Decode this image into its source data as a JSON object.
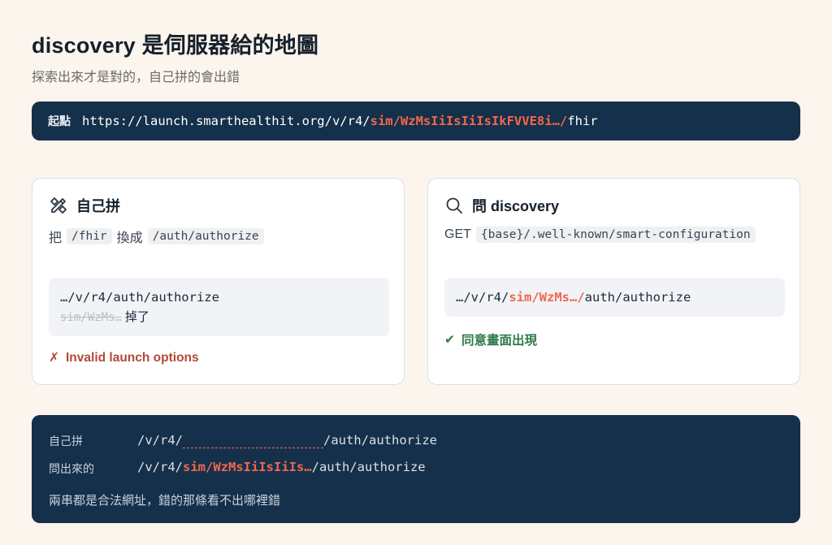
{
  "header": {
    "title": "discovery 是伺服器給的地圖",
    "subtitle": "探索出來才是對的，自己拼的會出錯"
  },
  "origin": {
    "label": "起點",
    "url_prefix": "https://launch.smarthealthit.org/v/r4/",
    "url_highlight": "sim/WzMsIiIsIiIsIkFVVE8i…/",
    "url_suffix": "fhir"
  },
  "left_card": {
    "icon": "pencil-ruler-icon",
    "title": "自己拼",
    "desc_prefix": "把",
    "chip_from": "/fhir",
    "desc_middle": "換成",
    "chip_to": "/auth/authorize",
    "code_line": "…/v/r4/auth/authorize",
    "code_dropped": "sim/WzMs…",
    "code_dropped_note": "掉了",
    "result_mark": "✗",
    "result_text": "Invalid launch options"
  },
  "right_card": {
    "icon": "search-icon",
    "title": "問 discovery",
    "desc_method": "GET",
    "chip_path": "{base}/.well-known/smart-configuration",
    "code_prefix": "…/v/r4/",
    "code_highlight": "sim/WzMs…/",
    "code_suffix": "auth/authorize",
    "result_mark": "✔",
    "result_text": "同意畫面出現"
  },
  "comparison": {
    "row1_label": "自己拼",
    "row1_prefix": "/v/r4/",
    "row1_suffix": "/auth/authorize",
    "row2_label": "問出來的",
    "row2_prefix": "/v/r4/",
    "row2_highlight": "sim/WzMsIiIsIiIs…",
    "row2_suffix": "/auth/authorize",
    "note": "兩串都是合法網址，錯的那條看不出哪裡錯"
  },
  "colors": {
    "background": "#fbf5ed",
    "dark_panel": "#15304a",
    "highlight": "#f0674f",
    "error": "#b24a38",
    "success": "#2f7a4a"
  }
}
